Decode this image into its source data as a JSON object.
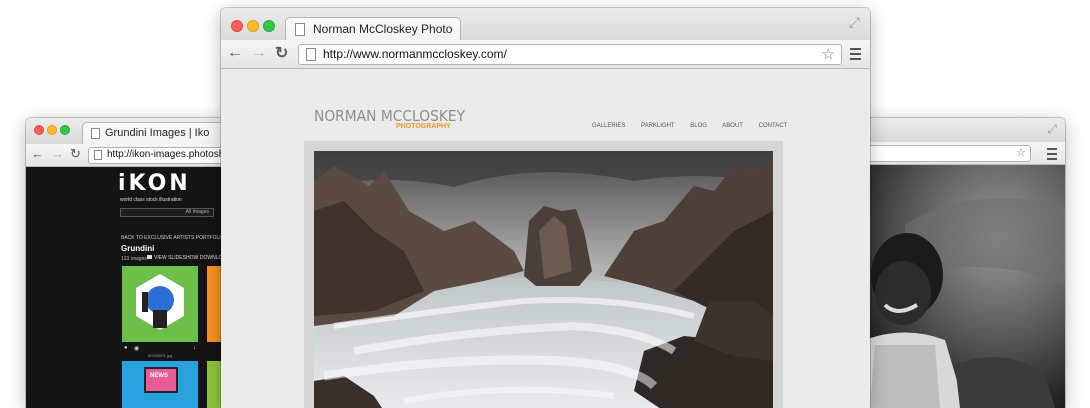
{
  "left_window": {
    "tab_title": "Grundini Images | Iko",
    "url": "http://ikon-images.photoshelter",
    "logo": "iKON",
    "tagline": "world class stock illustration",
    "search_placeholder": "All Images",
    "back_link": "BACK TO EXCLUSIVE ARTISTS PORTFOLIOS",
    "artist": "Grundini",
    "image_count": "133 images",
    "view_slideshow": "VIEW SLIDESHOW",
    "download": "DOWNLO",
    "thumb_caption": "50100001.jpg",
    "news_label": "NEWS"
  },
  "center_window": {
    "tab_title": "Norman McCloskey Photogra",
    "url": "http://www.normanmccloskey.com/",
    "site_name": "NORMAN MCCLOSKEY",
    "site_sub": "PHOTOGRAPHY",
    "nav": [
      "GALLERIES",
      "PARKLIGHT",
      "BLOG",
      "ABOUT",
      "CONTACT"
    ]
  },
  "colors": {
    "accent_orange": "#e8962a",
    "ikon_dark": "#141414"
  }
}
